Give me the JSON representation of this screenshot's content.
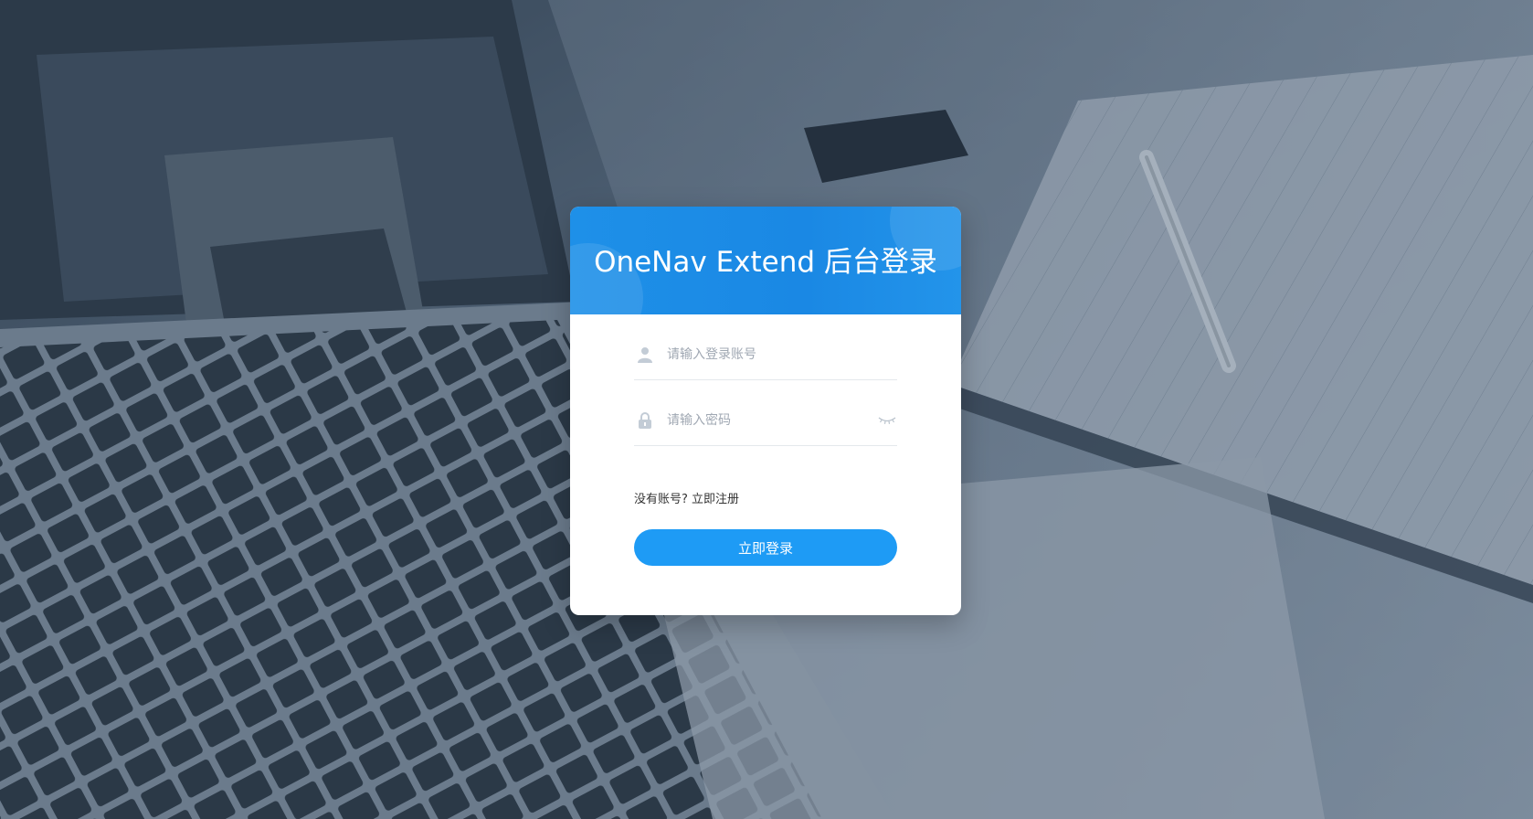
{
  "page": {
    "title": "OneNav Extend 后台登录"
  },
  "login_form": {
    "username_placeholder": "请输入登录账号",
    "password_placeholder": "请输入密码",
    "register_prompt": "没有账号?",
    "register_link": "立即注册",
    "submit_label": "立即登录"
  },
  "icons": {
    "username": "user-icon",
    "password": "lock-icon",
    "toggle_password": "eye-closed-icon"
  },
  "colors": {
    "header_blue": "#1a88e4",
    "button_blue": "#1e9bf5",
    "background_slate": "#4a5b6d"
  }
}
